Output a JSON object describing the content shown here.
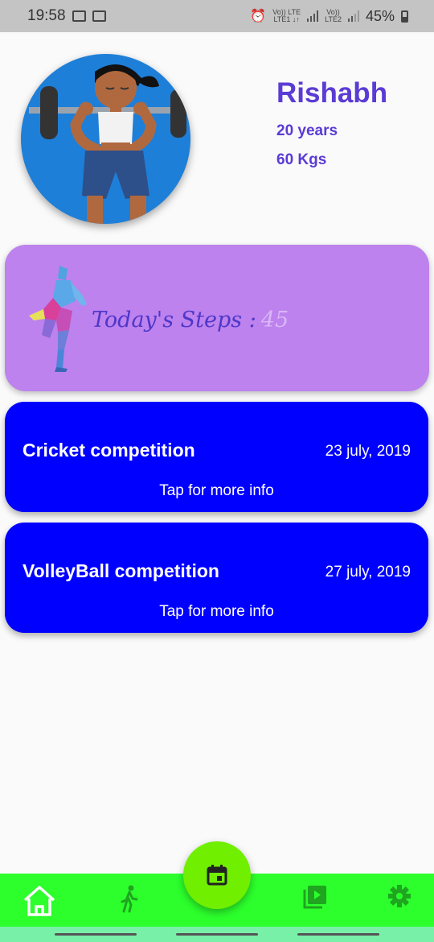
{
  "status_bar": {
    "time": "19:58",
    "sim1_label_top": "Vo)) LTE",
    "sim1_label_bottom": "LTE1 ↓↑",
    "sim2_label_top": "Vo))",
    "sim2_label_bottom": "LTE2",
    "battery": "45%"
  },
  "profile": {
    "name": "Rishabh",
    "age": "20 years",
    "weight": "60 Kgs"
  },
  "steps": {
    "label": "Today's Steps :",
    "value": "45"
  },
  "events": [
    {
      "title": "Cricket competition",
      "date": "23 july, 2019",
      "action": "Tap for more info"
    },
    {
      "title": "VolleyBall competition",
      "date": "27 july, 2019",
      "action": "Tap for more info"
    }
  ],
  "bottom_nav": {
    "items": [
      "home-icon",
      "walk-icon",
      "calendar-icon",
      "video-library-icon",
      "settings-icon"
    ],
    "active": "home-icon"
  },
  "colors": {
    "accent_purple": "#5b3bd5",
    "steps_card": "#bd82ee",
    "event_card": "#0000ff",
    "nav_bg": "#2cff2c",
    "fab": "#70ef00"
  }
}
